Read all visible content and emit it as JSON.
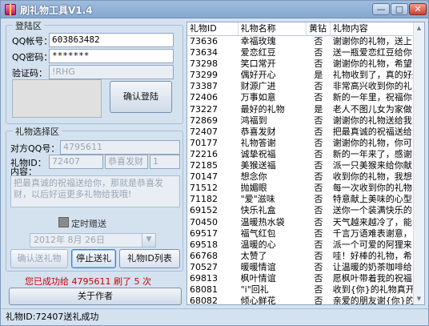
{
  "window": {
    "title": "刷礼物工具V1.4"
  },
  "login": {
    "legend": "登陆区",
    "qq_label": "QQ帐号：",
    "qq_value": "603863482",
    "pwd_label": "QQ密码：",
    "pwd_value": "*******",
    "captcha_label": "验证码：",
    "captcha_value": "!RHG",
    "confirm_button": "确认登陆"
  },
  "gift_select": {
    "legend": "礼物选择区",
    "target_label": "对方QQ号：",
    "target_value": "4795611",
    "gift_id_label": "礼物ID：",
    "gift_id_value": "72407",
    "gift_name_value": "恭喜发财",
    "gift_count_value": "1",
    "content_label": "内容：",
    "content_value": "把最真诚的祝福送给你，那就是恭喜发财，以后好运更多礼物给我哦!",
    "timed_label": "定时赠送",
    "date_value": "2012年 8月 26日",
    "confirm_send": "确认送礼物",
    "stop_send": "停止送礼",
    "gift_list": "礼物ID列表"
  },
  "status": {
    "success_msg": "您已成功给 4795611 刷了 5 次",
    "author_button": "关于作者",
    "statusbar": "礼物ID:72407送礼成功"
  },
  "list": {
    "columns": [
      "礼物ID",
      "礼物名称",
      "黄钻",
      "礼物内容"
    ],
    "rows": [
      [
        "73636",
        "幸福玫瑰",
        "否",
        "谢谢你的礼物，送上"
      ],
      [
        "73634",
        "爱恋红豆",
        "否",
        "送一瓶爱恋红豆给你"
      ],
      [
        "73298",
        "笑口常开",
        "否",
        "谢谢你的礼物，希望"
      ],
      [
        "73299",
        "偶好开心",
        "是",
        "礼物收到了，真的好开"
      ],
      [
        "73387",
        "财源广进",
        "否",
        "非常高兴收到你的礼"
      ],
      [
        "72406",
        "万事如意",
        "否",
        "新的一年里，祝福你"
      ],
      [
        "73227",
        "最好的礼物",
        "是",
        "老人不图儿女为家做"
      ],
      [
        "72869",
        "鸿福到",
        "否",
        "谢谢你的礼物送给我"
      ],
      [
        "72407",
        "恭喜发财",
        "否",
        "把最真诚的祝福送给"
      ],
      [
        "70177",
        "礼物答谢",
        "否",
        "谢谢你的礼物，你可"
      ],
      [
        "72216",
        "诚挚祝福",
        "否",
        "新的一年来了，感谢"
      ],
      [
        "72185",
        "美猴送福",
        "否",
        "派一只美猴来给你献"
      ],
      [
        "70147",
        "想念你",
        "否",
        "收到你的礼物，我想"
      ],
      [
        "71512",
        "抛媚眼",
        "否",
        "每一次收到你的礼物"
      ],
      [
        "71182",
        "\"爱\"滋味",
        "否",
        "特意献上美味的心型"
      ],
      [
        "69152",
        "快乐礼盒",
        "否",
        "送你一个装满快乐的"
      ],
      [
        "70450",
        "温暖热水袋",
        "否",
        "天气越来越冷了，能"
      ],
      [
        "69517",
        "福气红包",
        "否",
        "千言万语难表谢意，"
      ],
      [
        "69518",
        "温暖的心",
        "否",
        "派一个可爱的阿狸来"
      ],
      [
        "66768",
        "太赞了",
        "否",
        "哇！好棒的礼物，希"
      ],
      [
        "70527",
        "暖暖情谊",
        "否",
        "让温暖的奶茶咖啡给"
      ],
      [
        "69813",
        "枫叶情谊",
        "否",
        "愿枫叶带着我的祝福"
      ],
      [
        "68081",
        "\"i\"回礼",
        "否",
        "收到{你}的礼物真开"
      ],
      [
        "68082",
        "倾心鲜花",
        "否",
        "亲爱的朋友谢{你}的"
      ]
    ]
  }
}
